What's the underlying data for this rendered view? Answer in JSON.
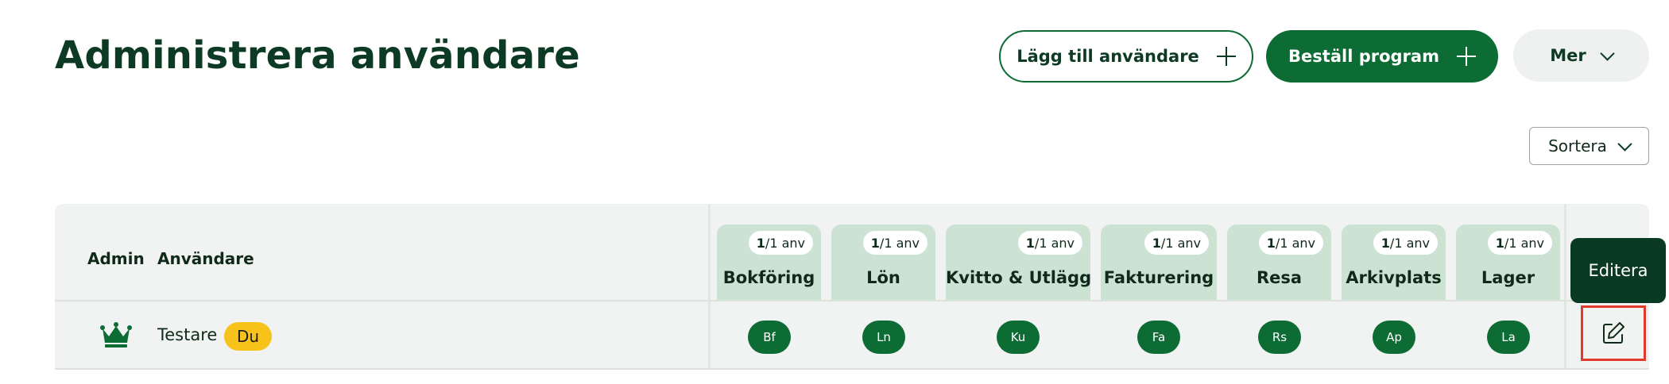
{
  "page": {
    "title": "Administrera användare"
  },
  "actions": {
    "add_user_label": "Lägg till användare",
    "order_program_label": "Beställ program",
    "more_label": "Mer"
  },
  "sort": {
    "label": "Sortera"
  },
  "table": {
    "headers": {
      "admin": "Admin",
      "user": "Användare"
    },
    "columns": [
      {
        "name": "Bokföring",
        "count_num": "1",
        "count_rest": "/1 anv",
        "abbr": "Bf"
      },
      {
        "name": "Lön",
        "count_num": "1",
        "count_rest": "/1 anv",
        "abbr": "Ln"
      },
      {
        "name": "Kvitto & Utlägg",
        "count_num": "1",
        "count_rest": "/1 anv",
        "abbr": "Ku"
      },
      {
        "name": "Fakturering",
        "count_num": "1",
        "count_rest": "/1 anv",
        "abbr": "Fa"
      },
      {
        "name": "Resa",
        "count_num": "1",
        "count_rest": "/1 anv",
        "abbr": "Rs"
      },
      {
        "name": "Arkivplats",
        "count_num": "1",
        "count_rest": "/1 anv",
        "abbr": "Ap"
      },
      {
        "name": "Lager",
        "count_num": "1",
        "count_rest": "/1 anv",
        "abbr": "La"
      }
    ],
    "rows": [
      {
        "name": "Testare",
        "badge": "Du",
        "is_admin": true
      }
    ]
  },
  "tooltip": {
    "edit_label": "Editera"
  },
  "colors": {
    "primary": "#0d6b34",
    "column_header": "#cce3d4",
    "badge": "#f7c21a",
    "highlight": "#e03a2a"
  },
  "icons": {
    "admin": "crown-icon",
    "edit": "edit-pencil-icon",
    "add": "plus-icon",
    "dropdown": "chevron-down-icon"
  }
}
